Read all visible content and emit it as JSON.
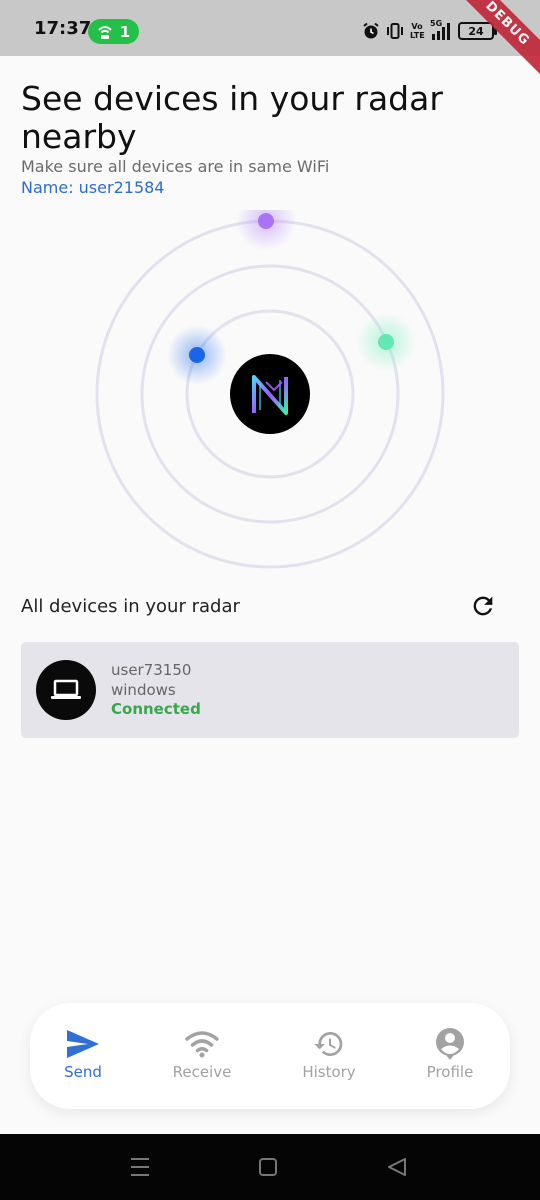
{
  "status_bar": {
    "time": "17:37",
    "hotspot_count": "1",
    "battery": "24",
    "network_label": "5G",
    "volte_label": "Vo LTE",
    "debug_label": "DEBUG"
  },
  "header": {
    "title": "See devices in your radar nearby",
    "subtitle": "Make sure all devices are in same WiFi",
    "name_line": "Name: user21584"
  },
  "radar": {
    "ring_color": "#e2e2ee",
    "dots": [
      {
        "name": "purple",
        "color": "#a873f5"
      },
      {
        "name": "blue",
        "color": "#1a64ea"
      },
      {
        "name": "green",
        "color": "#62e8b0"
      }
    ]
  },
  "devices_section": {
    "header": "All devices in your radar",
    "devices": [
      {
        "name": "user73150",
        "os": "windows",
        "status": "Connected",
        "icon": "laptop-icon"
      }
    ]
  },
  "nav": {
    "items": [
      {
        "label": "Send",
        "icon": "send-icon",
        "active": true
      },
      {
        "label": "Receive",
        "icon": "wifi-icon",
        "active": false
      },
      {
        "label": "History",
        "icon": "history-icon",
        "active": false
      },
      {
        "label": "Profile",
        "icon": "profile-icon",
        "active": false
      }
    ],
    "active_color": "#2f6fd6",
    "inactive_color": "#a2a2a2"
  }
}
